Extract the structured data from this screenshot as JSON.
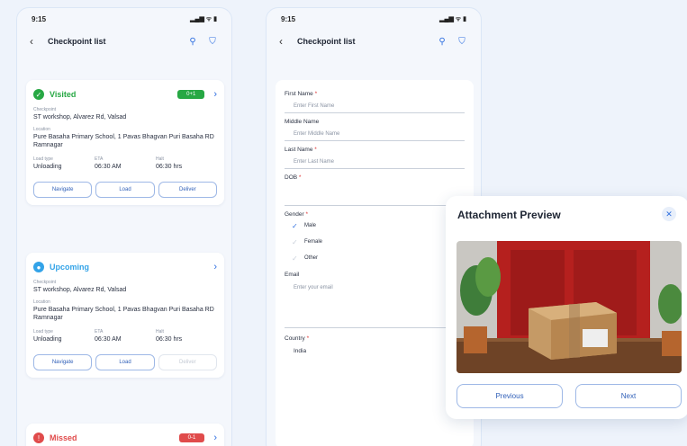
{
  "phone1": {
    "status": {
      "time": "9:15",
      "signal": "▂▄▆ ᯤ ▮"
    },
    "appbar": {
      "title": "Checkpoint list"
    },
    "cards": [
      {
        "status": "Visited",
        "badge": "0+1",
        "checkpoint_label": "Checkpoint",
        "checkpoint": "ST workshop, Alvarez Rd, Valsad",
        "location_label": "Location",
        "location": "Pure Basaha Primary School, 1 Pavas Bhagvan Puri Basaha RD Ramnagar",
        "col1_label": "Load type",
        "col1": "Unloading",
        "col2_label": "ETA",
        "col2": "06:30 AM",
        "col3_label": "Halt",
        "col3": "06:30 hrs",
        "buttons": [
          "Navigate",
          "Load",
          "Deliver"
        ]
      },
      {
        "status": "Upcoming",
        "checkpoint_label": "Checkpoint",
        "checkpoint": "ST workshop, Alvarez Rd, Valsad",
        "location_label": "Location",
        "location": "Pure Basaha Primary School, 1 Pavas Bhagvan Puri Basaha RD Ramnagar",
        "col1_label": "Load type",
        "col1": "Unloading",
        "col2_label": "ETA",
        "col2": "06:30 AM",
        "col3_label": "Halt",
        "col3": "06:30 hrs",
        "buttons": [
          "Navigate",
          "Load",
          "Deliver"
        ]
      },
      {
        "status": "Missed",
        "badge": "0-1"
      }
    ]
  },
  "phone2": {
    "status": {
      "time": "9:15",
      "signal": "▂▄▆ ᯤ ▮"
    },
    "appbar": {
      "title": "Checkpoint list"
    },
    "form": {
      "first_name_label": "First Name",
      "first_name_placeholder": "Enter First Name",
      "middle_name_label": "Middle Name",
      "middle_name_placeholder": "Enter Middle Name",
      "last_name_label": "Last Name",
      "last_name_placeholder": "Enter Last Name",
      "dob_label": "DOB",
      "gender_label": "Gender",
      "gender_options": [
        "Male",
        "Female",
        "Other"
      ],
      "email_label": "Email",
      "email_placeholder": "Enter your email",
      "country_label": "Country",
      "country_value": "India",
      "required_mark": "*"
    }
  },
  "modal": {
    "title": "Attachment Preview",
    "close_icon": "✕",
    "previous_label": "Previous",
    "next_label": "Next"
  },
  "colors": {
    "visited": "#27a844",
    "upcoming": "#33a3e8",
    "missed": "#e04b4b",
    "accent": "#2f6fe0"
  },
  "icons": [
    "back-arrow-icon",
    "search-icon",
    "filter-icon",
    "check-icon",
    "chevron-right-icon",
    "close-icon",
    "chevron-down-icon"
  ]
}
